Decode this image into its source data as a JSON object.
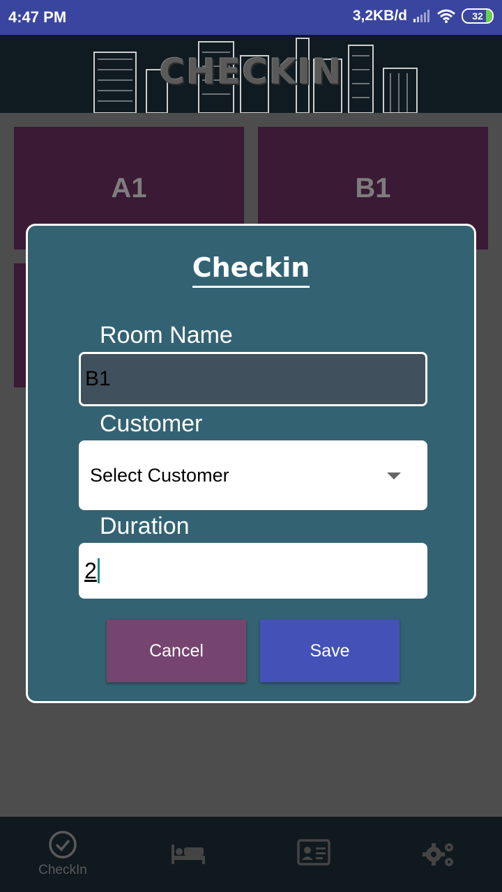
{
  "status_bar": {
    "time": "4:47 PM",
    "network_speed": "3,2KB/d",
    "battery_level": "32",
    "icons": [
      "signal-icon",
      "wifi-icon",
      "battery-icon"
    ]
  },
  "header": {
    "banner_title": "CHECKIN"
  },
  "rooms": [
    {
      "name": "A1"
    },
    {
      "name": "B1"
    }
  ],
  "dialog": {
    "title": "Checkin",
    "room_name_label": "Room Name",
    "room_name_value": "B1",
    "customer_label": "Customer",
    "customer_selected": "Select Customer",
    "duration_label": "Duration",
    "duration_value": "2",
    "cancel_label": "Cancel",
    "save_label": "Save"
  },
  "bottom_nav": {
    "items": [
      {
        "label": "CheckIn",
        "icon": "check-circle-icon",
        "active": true
      },
      {
        "label": "",
        "icon": "bed-icon",
        "active": false
      },
      {
        "label": "",
        "icon": "id-card-icon",
        "active": false
      },
      {
        "label": "",
        "icon": "gears-icon",
        "active": false
      }
    ]
  },
  "colors": {
    "status_bar": "#3a45a0",
    "dialog_bg": "#336373",
    "cancel_button": "#75446f",
    "save_button": "#4452b8",
    "room_card": "#3a1a34"
  }
}
